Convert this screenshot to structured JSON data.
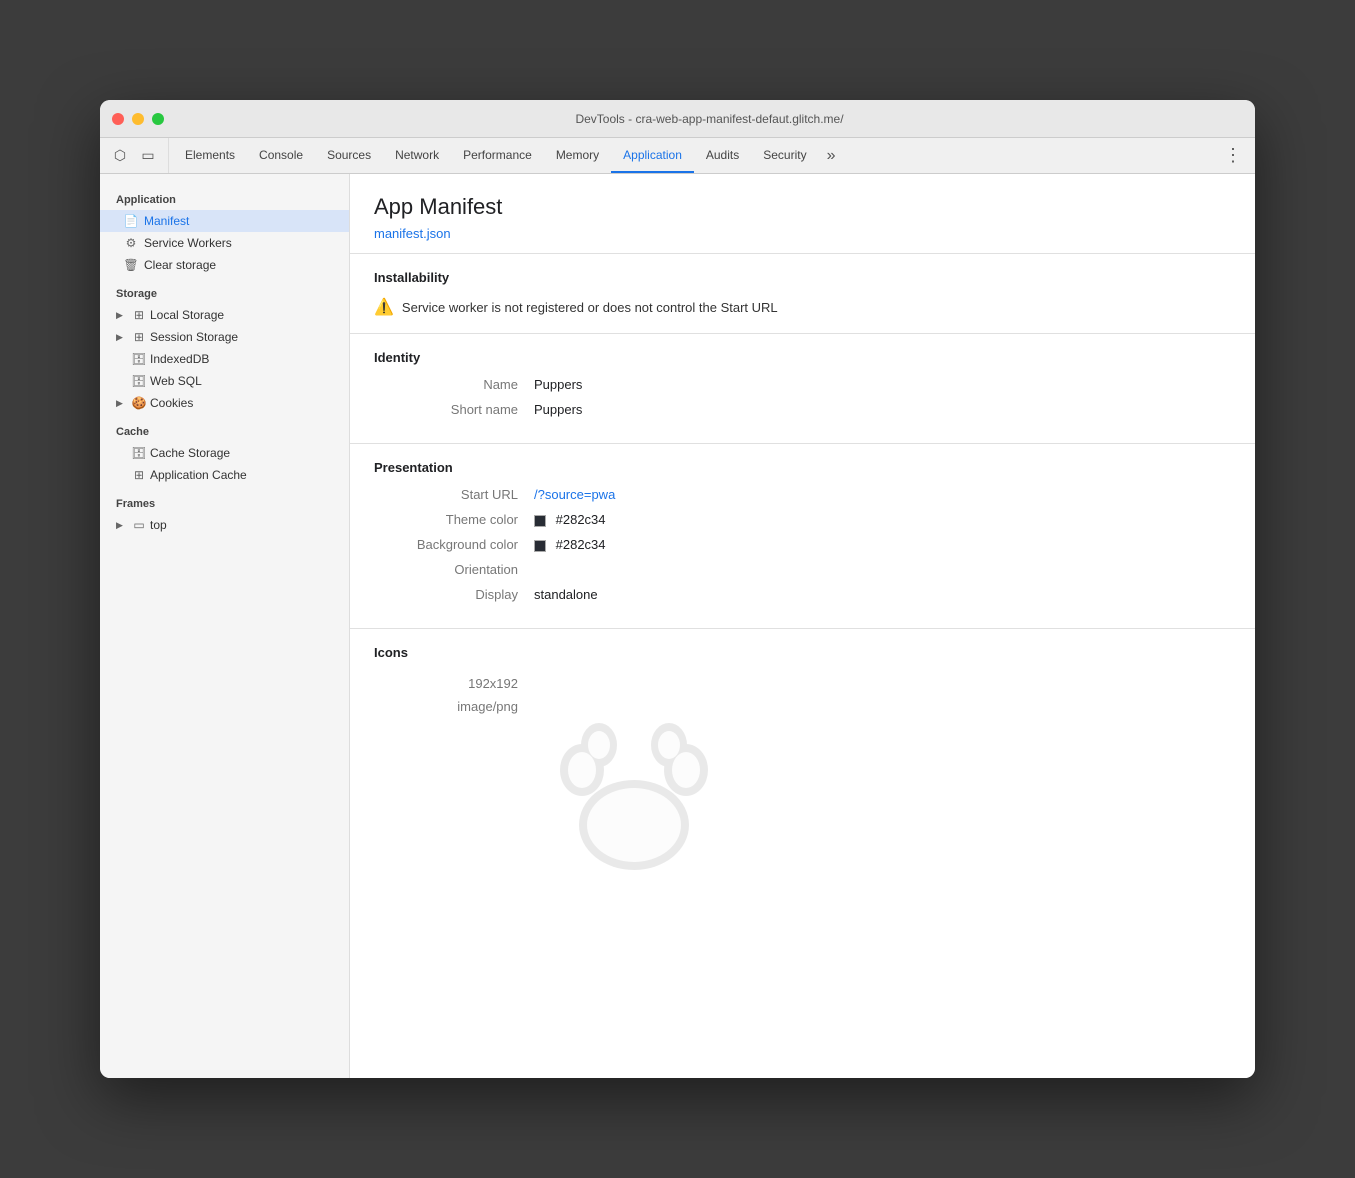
{
  "window": {
    "title": "DevTools - cra-web-app-manifest-defaut.glitch.me/"
  },
  "tabs": {
    "items": [
      {
        "label": "Elements",
        "active": false
      },
      {
        "label": "Console",
        "active": false
      },
      {
        "label": "Sources",
        "active": false
      },
      {
        "label": "Network",
        "active": false
      },
      {
        "label": "Performance",
        "active": false
      },
      {
        "label": "Memory",
        "active": false
      },
      {
        "label": "Application",
        "active": true
      },
      {
        "label": "Audits",
        "active": false
      },
      {
        "label": "Security",
        "active": false
      }
    ],
    "more_label": "»",
    "menu_label": "⋮"
  },
  "sidebar": {
    "application_label": "Application",
    "items_application": [
      {
        "label": "Manifest",
        "icon": "📄",
        "active": true
      },
      {
        "label": "Service Workers",
        "icon": "⚙️",
        "active": false
      },
      {
        "label": "Clear storage",
        "icon": "🗑️",
        "active": false
      }
    ],
    "storage_label": "Storage",
    "items_storage": [
      {
        "label": "Local Storage",
        "has_arrow": true
      },
      {
        "label": "Session Storage",
        "has_arrow": true
      },
      {
        "label": "IndexedDB",
        "has_arrow": false
      },
      {
        "label": "Web SQL",
        "has_arrow": false
      },
      {
        "label": "Cookies",
        "has_arrow": true
      }
    ],
    "cache_label": "Cache",
    "items_cache": [
      {
        "label": "Cache Storage"
      },
      {
        "label": "Application Cache"
      }
    ],
    "frames_label": "Frames",
    "items_frames": [
      {
        "label": "top"
      }
    ]
  },
  "content": {
    "title": "App Manifest",
    "manifest_link": "manifest.json",
    "installability": {
      "section_title": "Installability",
      "warning_text": "Service worker is not registered or does not control the Start URL"
    },
    "identity": {
      "section_title": "Identity",
      "name_label": "Name",
      "name_value": "Puppers",
      "short_name_label": "Short name",
      "short_name_value": "Puppers"
    },
    "presentation": {
      "section_title": "Presentation",
      "start_url_label": "Start URL",
      "start_url_value": "/?source=pwa",
      "theme_color_label": "Theme color",
      "theme_color_value": "#282c34",
      "theme_color_hex": "#282c34",
      "bg_color_label": "Background color",
      "bg_color_value": "#282c34",
      "bg_color_hex": "#282c34",
      "orientation_label": "Orientation",
      "orientation_value": "",
      "display_label": "Display",
      "display_value": "standalone"
    },
    "icons": {
      "section_title": "Icons",
      "size": "192x192",
      "type": "image/png"
    }
  }
}
